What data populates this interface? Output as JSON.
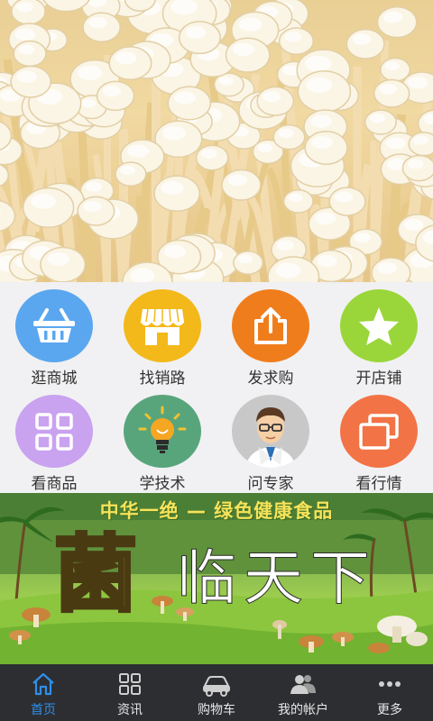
{
  "grid": {
    "items": [
      {
        "label": "逛商城",
        "icon": "basket-icon",
        "color": "#5aa7ef"
      },
      {
        "label": "找销路",
        "icon": "storefront-icon",
        "color": "#f3b81a"
      },
      {
        "label": "发求购",
        "icon": "share-upload-icon",
        "color": "#f07d1c"
      },
      {
        "label": "开店铺",
        "icon": "star-icon",
        "color": "#9ad63a"
      },
      {
        "label": "看商品",
        "icon": "grid-icon",
        "color": "#c9a2f0"
      },
      {
        "label": "学技术",
        "icon": "lightbulb-icon",
        "color": "#58a57c"
      },
      {
        "label": "问专家",
        "icon": "expert-avatar-icon",
        "color": "#c8c8c8"
      },
      {
        "label": "看行情",
        "icon": "gallery-icon",
        "color": "#f27345"
      }
    ]
  },
  "banner": {
    "slogan": "中华一绝 — 绿色健康食品",
    "big_char": "菌",
    "rest": "临天下"
  },
  "tabbar": {
    "items": [
      {
        "label": "首页",
        "icon": "home-icon",
        "active": true
      },
      {
        "label": "资讯",
        "icon": "news-grid-icon",
        "active": false
      },
      {
        "label": "购物车",
        "icon": "cart-icon",
        "active": false
      },
      {
        "label": "我的帐户",
        "icon": "account-icon",
        "active": false
      },
      {
        "label": "更多",
        "icon": "more-icon",
        "active": false
      }
    ]
  },
  "colors": {
    "tab_active": "#2f8fe8",
    "tabbar_bg": "#2d2e32",
    "grid_bg": "#f1f1f3"
  }
}
